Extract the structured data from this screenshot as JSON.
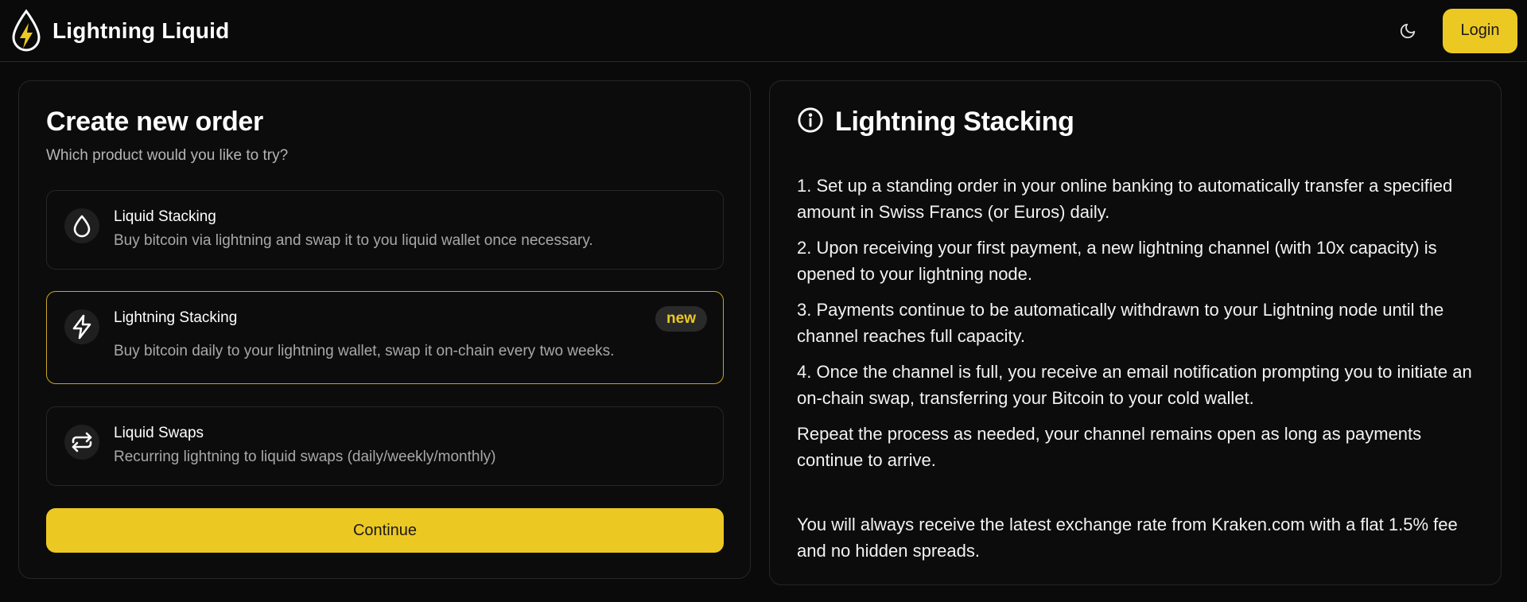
{
  "header": {
    "brand_title": "Lightning Liquid",
    "login_label": "Login"
  },
  "order": {
    "title": "Create new order",
    "subtitle": "Which product would you like to try?",
    "products": [
      {
        "name": "Liquid Stacking",
        "description": "Buy bitcoin via lightning and swap it to you liquid wallet once necessary.",
        "icon": "droplet-icon"
      },
      {
        "name": "Lightning Stacking",
        "description": "Buy bitcoin daily to your lightning wallet, swap it on-chain every two weeks.",
        "badge": "new",
        "icon": "lightning-bolt-icon",
        "selected": true
      },
      {
        "name": "Liquid Swaps",
        "description": "Recurring lightning to liquid swaps (daily/weekly/monthly)",
        "icon": "swap-arrows-icon"
      }
    ],
    "continue_label": "Continue"
  },
  "info": {
    "title": "Lightning Stacking",
    "steps": [
      "1. Set up a standing order in your online banking to automatically transfer a specified amount in Swiss Francs (or Euros) daily.",
      "2. Upon receiving your first payment, a new lightning channel (with 10x capacity) is opened to your lightning node.",
      "3. Payments continue to be automatically withdrawn to your Lightning node until the channel reaches full capacity.",
      "4. Once the channel is full, you receive an email notification prompting you to initiate an on-chain swap, transferring your Bitcoin to your cold wallet.",
      "Repeat the process as needed, your channel remains open as long as payments continue to arrive."
    ],
    "footer": "You will always receive the latest exchange rate from Kraken.com with a flat 1.5% fee and no hidden spreads."
  },
  "colors": {
    "accent": "#ecc823",
    "background": "#0a0a0a",
    "border": "#262626"
  }
}
